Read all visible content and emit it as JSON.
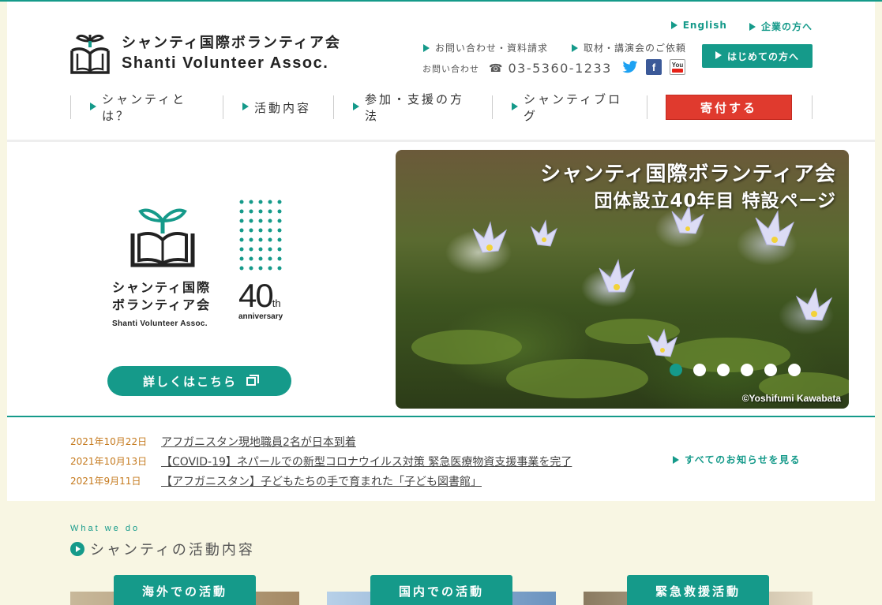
{
  "header": {
    "logo_jp": "シャンティ国際ボランティア会",
    "logo_en": "Shanti Volunteer Assoc.",
    "util_links": [
      "English",
      "企業の方へ"
    ],
    "contact_links": [
      "お問い合わせ・資料請求",
      "取材・講演会のご依頼"
    ],
    "phone_label": "お問い合わせ",
    "phone_number": "03-5360-1233",
    "first_time_button": "はじめての方へ",
    "social": [
      {
        "name": "twitter-icon",
        "color": "#1da1f2"
      },
      {
        "name": "facebook-icon",
        "color": "#3b5998",
        "glyph": "f"
      },
      {
        "name": "youtube-icon",
        "color": "#e62117",
        "glyph": "You"
      }
    ]
  },
  "nav": {
    "items": [
      "シャンティとは？",
      "活動内容",
      "参加・支援の方法",
      "シャンティブログ"
    ],
    "donate": "寄付する"
  },
  "hero": {
    "logo_jp_line1": "シャンティ国際",
    "logo_jp_line2": "ボランティア会",
    "logo_en": "Shanti Volunteer Assoc.",
    "anniv_number": "40",
    "anniv_suffix": "th",
    "anniv_word": "anniversary",
    "detail_button": "詳しくはこちら"
  },
  "slideshow": {
    "title": "シャンティ国際ボランティア会",
    "subtitle": "団体設立40年目 特設ページ",
    "credit": "©Yoshifumi Kawabata",
    "slide_count": 6,
    "active_index": 0,
    "accent": "#159a8a"
  },
  "news": {
    "items": [
      {
        "date": "2021年10月22日",
        "title": "アフガニスタン現地職員2名が日本到着"
      },
      {
        "date": "2021年10月13日",
        "title": "【COVID-19】ネパールでの新型コロナウイルス対策 緊急医療物資支援事業を完了"
      },
      {
        "date": "2021年9月11日",
        "title": "【アフガニスタン】子どもたちの手で育まれた「子ども図書館」"
      }
    ],
    "all_link": "すべてのお知らせを見る"
  },
  "activities": {
    "heading_en": "What we do",
    "heading_jp": "シャンティの活動内容",
    "cards": [
      "海外での活動",
      "国内での活動",
      "緊急救援活動"
    ]
  },
  "colors": {
    "brand": "#159a8a",
    "donate": "#e03a2e",
    "date": "#c57a1e",
    "background": "#f8f6e3"
  }
}
